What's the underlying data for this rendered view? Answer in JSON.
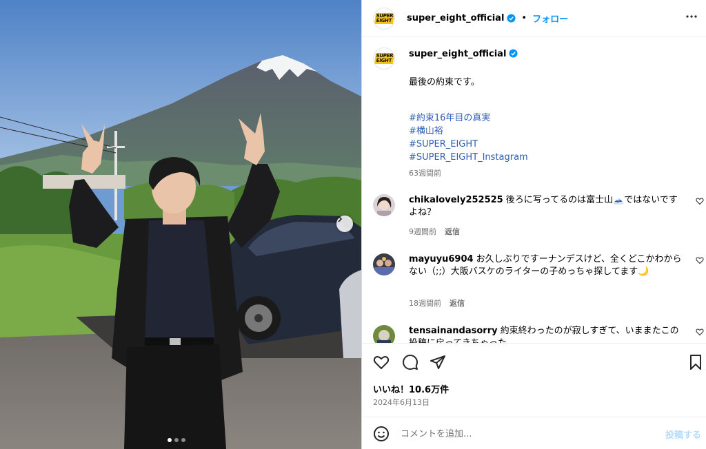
{
  "account": {
    "username": "super_eight_official",
    "logo_text": "SUPER EIGHT"
  },
  "header": {
    "separator": "•",
    "follow_label": "フォロー"
  },
  "caption": {
    "text": "最後の約束です。",
    "hashtags": [
      "#約束16年目の真実",
      "#横山裕",
      "#SUPER_EIGHT",
      "#SUPER_EIGHT_Instagram"
    ],
    "time": "63週間前"
  },
  "comments": [
    {
      "username": "chikalovely252525",
      "text": "後ろに写ってるのは富士山🗻ではないですよね？",
      "time": "9週間前",
      "reply_label": "返信"
    },
    {
      "username": "mayuyu6904",
      "text": "お久しぶりですーナンデスけど、全くどこかわからない（;;）大阪バスケのライターの子めっちゃ探してます🌙",
      "time": "18週間前",
      "reply_label": "返信"
    },
    {
      "username": "tensainandasorry",
      "text": "約束終わったのが寂しすぎて、いままたこの投稿に戻ってきちゃった",
      "time": "",
      "reply_label": ""
    }
  ],
  "actions": {
    "likes": "いいね！10.6万件",
    "date": "2024年6月13日"
  },
  "compose": {
    "placeholder": "コメントを追加...",
    "post_label": "投稿する"
  },
  "icons": {
    "like": "heart-icon",
    "comment": "comment-icon",
    "share": "share-icon",
    "save": "bookmark-icon",
    "emoji": "emoji-icon",
    "more": "more-icon",
    "verified": "verified-badge-icon",
    "next": "chevron-right-icon"
  },
  "colors": {
    "accent": "#0095f6",
    "hashtag": "#2e5db3",
    "muted": "#737373",
    "post_disabled": "#b3dbff"
  },
  "carousel": {
    "total": 3,
    "active": 1
  }
}
